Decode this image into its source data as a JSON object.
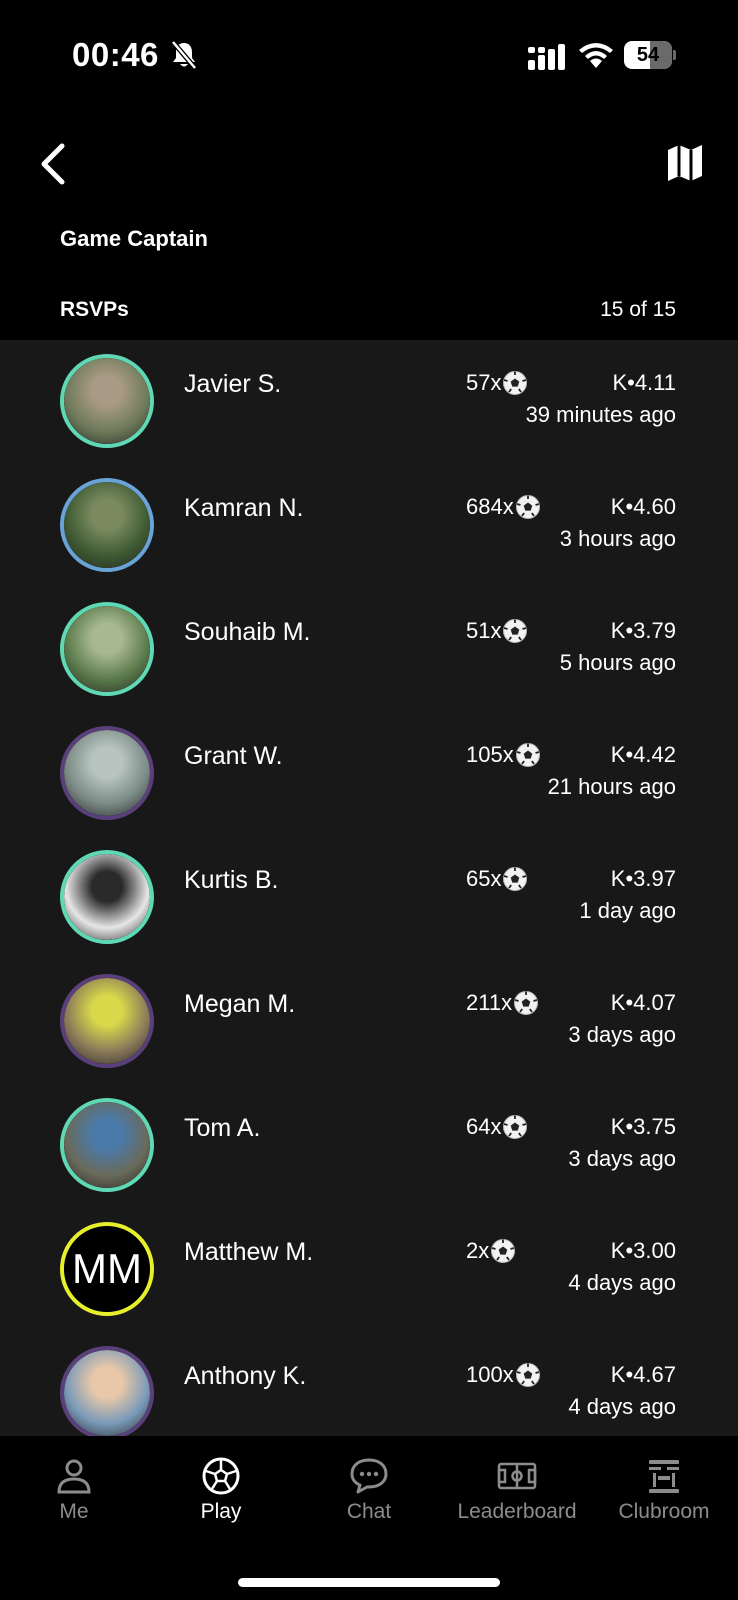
{
  "status_bar": {
    "time": "00:46",
    "battery": "54"
  },
  "header": {
    "section_title": "Game Captain",
    "rsvps_title": "RSVPs",
    "rsvps_count": "15 of 15"
  },
  "rsvps": [
    {
      "name": "Javier S.",
      "games": "57x",
      "rating": "K•4.11",
      "time": "39 minutes ago",
      "ring": "#5fd8b5",
      "photo_colors": [
        "#6e7a5a",
        "#a89a84"
      ]
    },
    {
      "name": "Kamran N.",
      "games": "684x",
      "rating": "K•4.60",
      "time": "3 hours ago",
      "ring": "#6aa3d8",
      "photo_colors": [
        "#3e5a32",
        "#7a8a5e"
      ]
    },
    {
      "name": "Souhaib M.",
      "games": "51x",
      "rating": "K•3.79",
      "time": "5 hours ago",
      "ring": "#5fd8b5",
      "photo_colors": [
        "#5a7a4a",
        "#a8b890"
      ]
    },
    {
      "name": "Grant W.",
      "games": "105x",
      "rating": "K•4.42",
      "time": "21 hours ago",
      "ring": "#5a3f7a",
      "photo_colors": [
        "#7a8a84",
        "#b8c4c0"
      ]
    },
    {
      "name": "Kurtis B.",
      "games": "65x",
      "rating": "K•3.97",
      "time": "1 day ago",
      "ring": "#5fd8b5",
      "photo_colors": [
        "#e6e6e6",
        "#2a2a2a"
      ]
    },
    {
      "name": "Megan M.",
      "games": "211x",
      "rating": "K•4.07",
      "time": "3 days ago",
      "ring": "#5a3f7a",
      "photo_colors": [
        "#8a7a5a",
        "#d8d84a"
      ]
    },
    {
      "name": "Tom A.",
      "games": "64x",
      "rating": "K•3.75",
      "time": "3 days ago",
      "ring": "#5fd8b5",
      "photo_colors": [
        "#6a6a5a",
        "#4a7aa8"
      ]
    },
    {
      "name": "Matthew M.",
      "games": "2x",
      "rating": "K•3.00",
      "time": "4 days ago",
      "ring": "#e6f02a",
      "initials": "MM"
    },
    {
      "name": "Anthony K.",
      "games": "100x",
      "rating": "K•4.67",
      "time": "4 days ago",
      "ring": "#5a3f7a",
      "photo_colors": [
        "#7a9ab8",
        "#e8c8a8"
      ]
    }
  ],
  "tabs": [
    {
      "label": "Me",
      "icon": "person-icon",
      "active": false
    },
    {
      "label": "Play",
      "icon": "soccer-ball-icon",
      "active": true
    },
    {
      "label": "Chat",
      "icon": "chat-bubble-icon",
      "active": false
    },
    {
      "label": "Leaderboard",
      "icon": "pitch-icon",
      "active": false
    },
    {
      "label": "Clubroom",
      "icon": "clubroom-icon",
      "active": false
    }
  ]
}
